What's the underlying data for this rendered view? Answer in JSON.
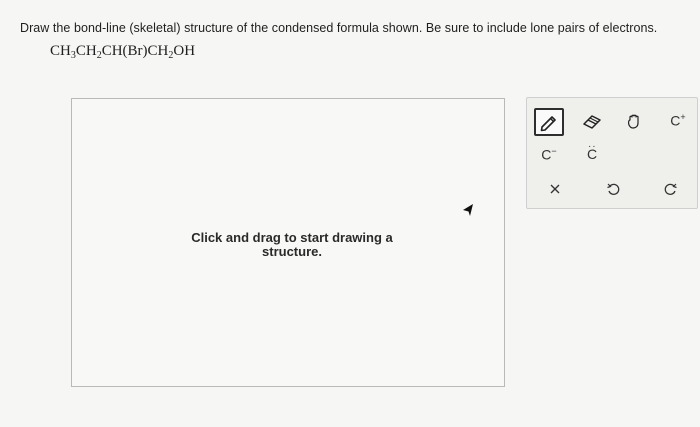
{
  "question": {
    "text": "Draw the bond-line (skeletal) structure of the condensed formula shown. Be sure to include lone pairs of electrons."
  },
  "formula": {
    "parts": [
      "CH",
      "3",
      "CH",
      "2",
      "CH(Br)CH",
      "2",
      "OH"
    ]
  },
  "canvas": {
    "prompt": "Click and drag to start drawing a structure."
  },
  "toolbar": {
    "carbanion_label": "C",
    "carbanion_sup": "−",
    "lone_pair_carbon_label": "C",
    "carbocation_label": "C",
    "carbocation_sup": "+",
    "tools": [
      {
        "name": "pencil-icon",
        "selected": true
      },
      {
        "name": "eraser-icon",
        "selected": false
      },
      {
        "name": "hand-icon",
        "selected": false
      },
      {
        "name": "carbocation",
        "selected": false
      },
      {
        "name": "carbanion",
        "selected": false
      },
      {
        "name": "lone-pair-carbon",
        "selected": false
      },
      {
        "name": "close-icon",
        "selected": false
      },
      {
        "name": "undo-icon",
        "selected": false
      },
      {
        "name": "redo-icon",
        "selected": false
      }
    ]
  }
}
